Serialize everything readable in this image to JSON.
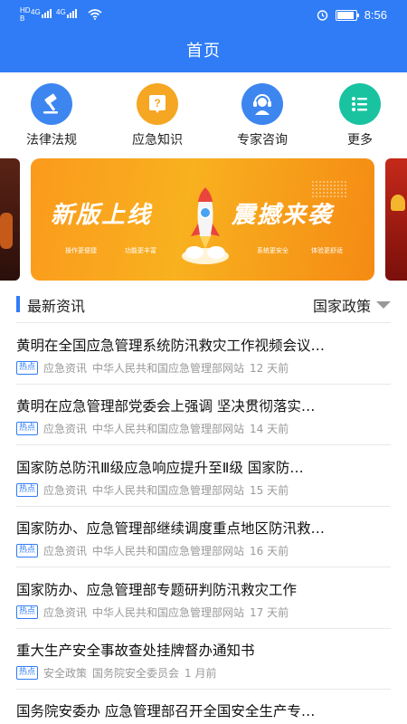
{
  "status_bar": {
    "left_labels": [
      "HD",
      "B"
    ],
    "network": [
      "4G",
      "4G"
    ],
    "time": "8:56"
  },
  "header": {
    "title": "首页"
  },
  "quick_nav": [
    {
      "label": "法律法规",
      "icon": "gavel-icon",
      "color": "#3d86f0"
    },
    {
      "label": "应急知识",
      "icon": "question-icon",
      "color": "#f5a623"
    },
    {
      "label": "专家咨询",
      "icon": "headset-icon",
      "color": "#3d86f0"
    },
    {
      "label": "更多",
      "icon": "list-icon",
      "color": "#19c3a0"
    }
  ],
  "banner": {
    "left_text": "新版上线",
    "right_text": "震撼来袭",
    "features": [
      "操作更便捷",
      "功能更丰富",
      "系统更安全",
      "体验更舒适"
    ]
  },
  "section": {
    "title": "最新资讯",
    "filter": "国家政策"
  },
  "news": [
    {
      "title": "黄明在全国应急管理系统防汛救灾工作视频会议…",
      "tag": "热点",
      "category": "应急资讯",
      "source": "中华人民共和国应急管理部网站",
      "time": "12 天前"
    },
    {
      "title": "黄明在应急管理部党委会上强调 坚决贯彻落实…",
      "tag": "热点",
      "category": "应急资讯",
      "source": "中华人民共和国应急管理部网站",
      "time": "14 天前"
    },
    {
      "title": "国家防总防汛Ⅲ级应急响应提升至Ⅱ级 国家防…",
      "tag": "热点",
      "category": "应急资讯",
      "source": "中华人民共和国应急管理部网站",
      "time": "15 天前"
    },
    {
      "title": "国家防办、应急管理部继续调度重点地区防汛救…",
      "tag": "热点",
      "category": "应急资讯",
      "source": "中华人民共和国应急管理部网站",
      "time": "16 天前"
    },
    {
      "title": "国家防办、应急管理部专题研判防汛救灾工作",
      "tag": "热点",
      "category": "应急资讯",
      "source": "中华人民共和国应急管理部网站",
      "time": "17 天前"
    },
    {
      "title": "重大生产安全事故查处挂牌督办通知书",
      "tag": "热点",
      "category": "安全政策",
      "source": "国务院安全委员会",
      "time": "1 月前"
    },
    {
      "title": "国务院安委办 应急管理部召开全国安全生产专…",
      "tag": "",
      "category": "",
      "source": "",
      "time": ""
    }
  ]
}
